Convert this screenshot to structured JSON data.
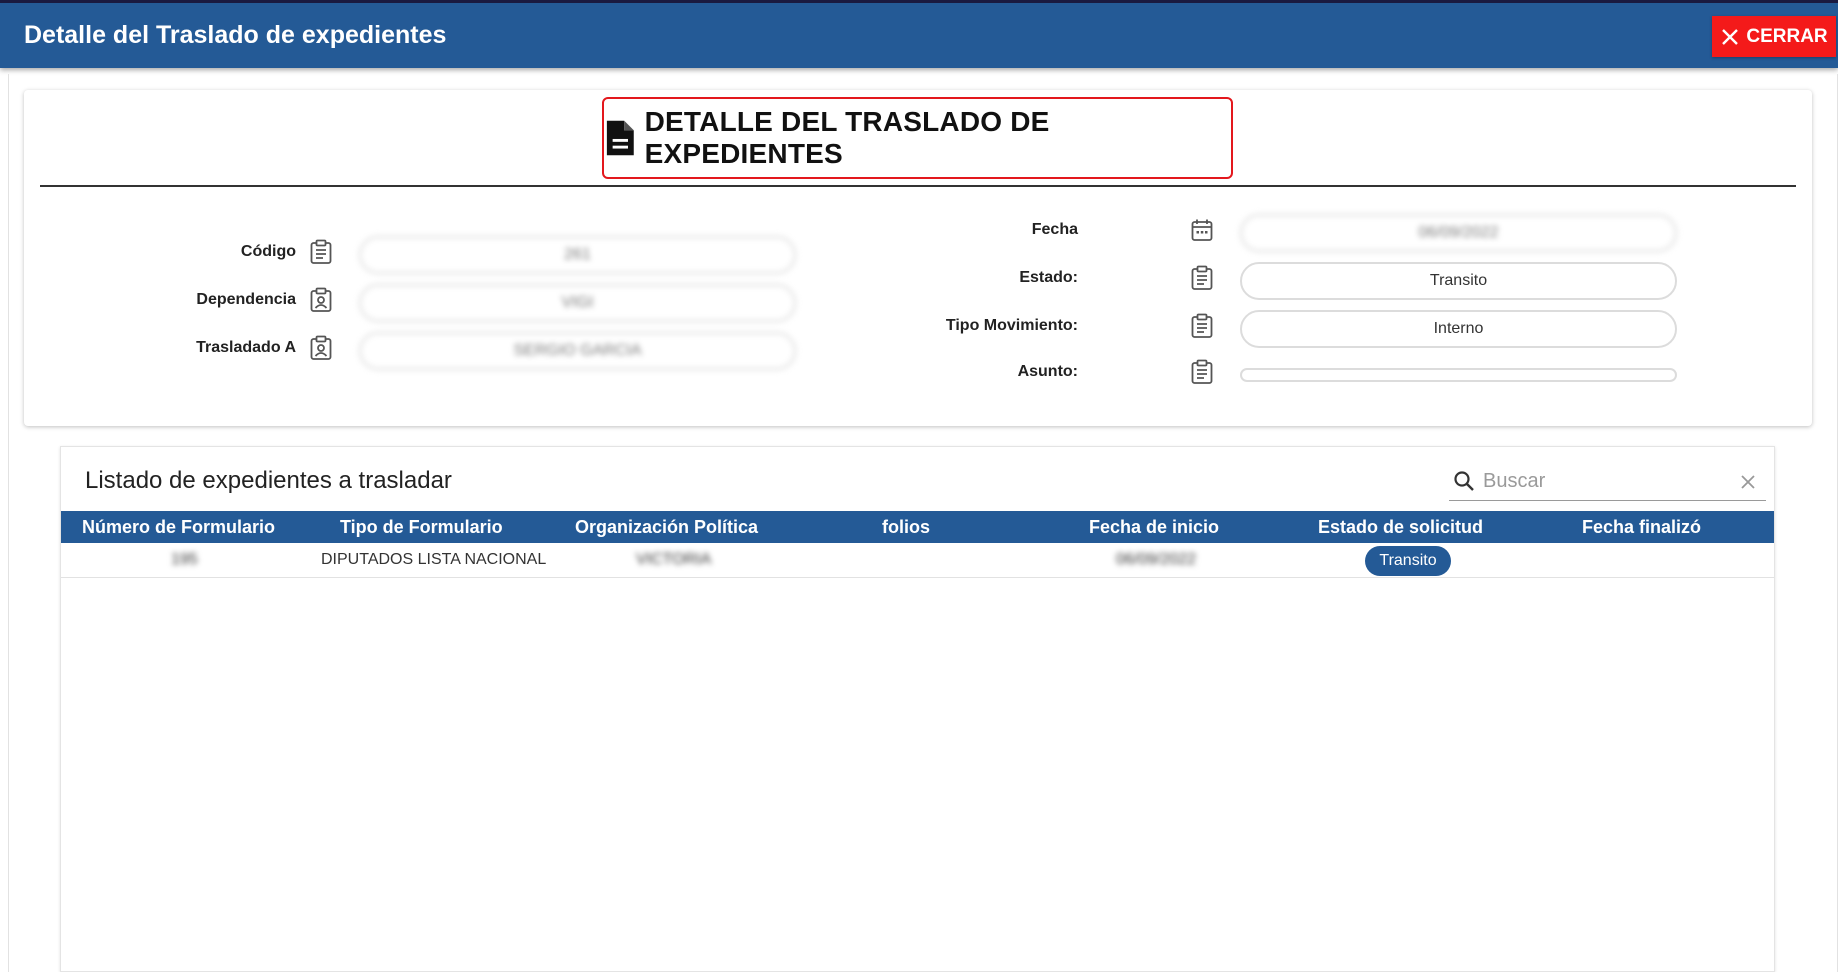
{
  "window": {
    "title": "Detalle del Traslado de expedientes",
    "close_label": "CERRAR"
  },
  "detail": {
    "heading": "DETALLE DEL TRASLADO DE EXPEDIENTES",
    "fields": {
      "codigo": {
        "label": "Código",
        "value": "261"
      },
      "dependencia": {
        "label": "Dependencia",
        "value": "VIGI"
      },
      "trasladado_a": {
        "label": "Trasladado A",
        "value": "SERGIO GARCIA"
      },
      "fecha": {
        "label": "Fecha",
        "value": "06/09/2022"
      },
      "estado": {
        "label": "Estado:",
        "value": "Transito"
      },
      "tipo_movimiento": {
        "label": "Tipo Movimiento:",
        "value": "Interno"
      },
      "asunto": {
        "label": "Asunto:",
        "value": ""
      }
    }
  },
  "listado": {
    "title": "Listado de expedientes a trasladar",
    "search_placeholder": "Buscar",
    "columns": [
      "Número de Formulario",
      "Tipo de Formulario",
      "Organización Política",
      "folios",
      "Fecha de inicio",
      "Estado de solicitud",
      "Fecha finalizó"
    ],
    "rows": [
      {
        "numero": "195",
        "tipo": "DIPUTADOS LISTA NACIONAL",
        "organizacion": "VICTORIA",
        "folios": "",
        "fecha_inicio": "06/09/2022",
        "estado": "Transito",
        "fecha_finalizo": ""
      }
    ]
  },
  "colors": {
    "header_blue": "#245a96",
    "close_red": "#f41a1a",
    "highlight_red": "#e3181d"
  },
  "icons": {
    "close": "close-icon",
    "heading": "file-document-icon",
    "clipboard": "clipboard-icon",
    "contact": "contact-icon",
    "calendar": "calendar-icon",
    "search": "search-icon",
    "clear": "clear-icon"
  }
}
